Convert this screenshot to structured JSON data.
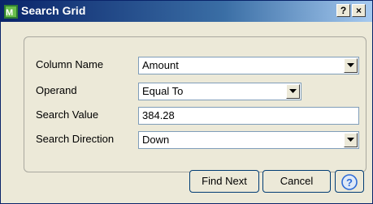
{
  "window": {
    "title": "Search Grid",
    "help_glyph": "?",
    "close_glyph": "×"
  },
  "form": {
    "column_name": {
      "label": "Column Name",
      "value": "Amount"
    },
    "operand": {
      "label": "Operand",
      "value": "Equal To"
    },
    "search_value": {
      "label": "Search Value",
      "value": "384.28"
    },
    "search_direction": {
      "label": "Search Direction",
      "value": "Down"
    }
  },
  "buttons": {
    "find_next": "Find Next",
    "cancel": "Cancel",
    "help": "help-icon"
  },
  "icons": {
    "app": "mas-app-icon",
    "dropdown": "chevron-down-icon"
  },
  "colors": {
    "titlebar_start": "#0a246a",
    "titlebar_end": "#a6caf0",
    "help_circle": "#2e6bd6"
  }
}
